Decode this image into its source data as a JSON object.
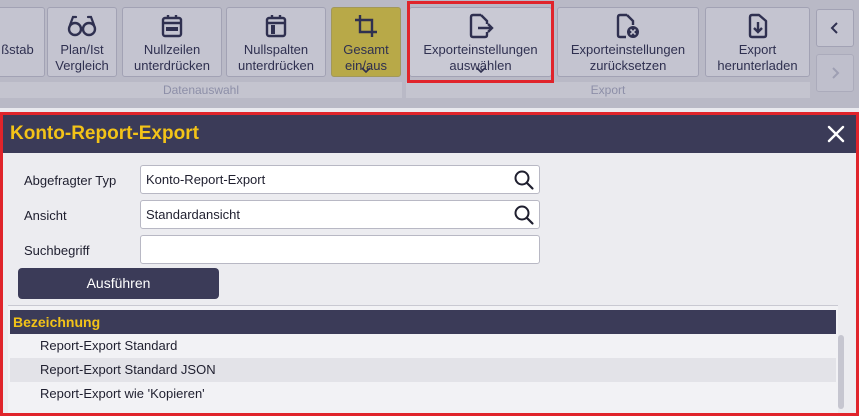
{
  "ribbon": {
    "buttons": [
      {
        "label1": "ßstab",
        "label2": "",
        "icon": "scale-icon"
      },
      {
        "label1": "Plan/Ist",
        "label2": "Vergleich",
        "icon": "glasses-icon"
      },
      {
        "label1": "Nullzeilen",
        "label2": "unterdrücken",
        "icon": "calendar-rows-icon"
      },
      {
        "label1": "Nullspalten",
        "label2": "unterdrücken",
        "icon": "calendar-columns-icon"
      },
      {
        "label1": "Gesamt",
        "label2": "ein/aus",
        "icon": "crop-icon"
      },
      {
        "label1": "Exporteinstellungen",
        "label2": "auswählen",
        "icon": "file-export-icon"
      },
      {
        "label1": "Exporteinstellungen",
        "label2": "zurücksetzen",
        "icon": "file-reset-icon"
      },
      {
        "label1": "Export",
        "label2": "herunterladen",
        "icon": "file-download-icon"
      }
    ],
    "groups": {
      "datenauswahl": "Datenauswahl",
      "export": "Export"
    },
    "nav": {
      "prev": "‹",
      "next": "›"
    }
  },
  "dialog": {
    "title": "Konto-Report-Export",
    "close_icon": "close-icon",
    "fields": {
      "typ": {
        "label": "Abgefragter Typ",
        "value": "Konto-Report-Export"
      },
      "ansicht": {
        "label": "Ansicht",
        "value": "Standardansicht"
      },
      "suchbegriff": {
        "label": "Suchbegriff",
        "value": ""
      }
    },
    "run_label": "Ausführen",
    "list": {
      "header": "Bezeichnung",
      "rows": [
        "Report-Export Standard",
        "Report-Export Standard JSON",
        "Report-Export wie 'Kopieren'"
      ]
    }
  },
  "colors": {
    "header_bg": "#3b3b58",
    "title": "#f3c318",
    "highlight": "#e0242b",
    "gesamt_bg": "#b8a948"
  }
}
